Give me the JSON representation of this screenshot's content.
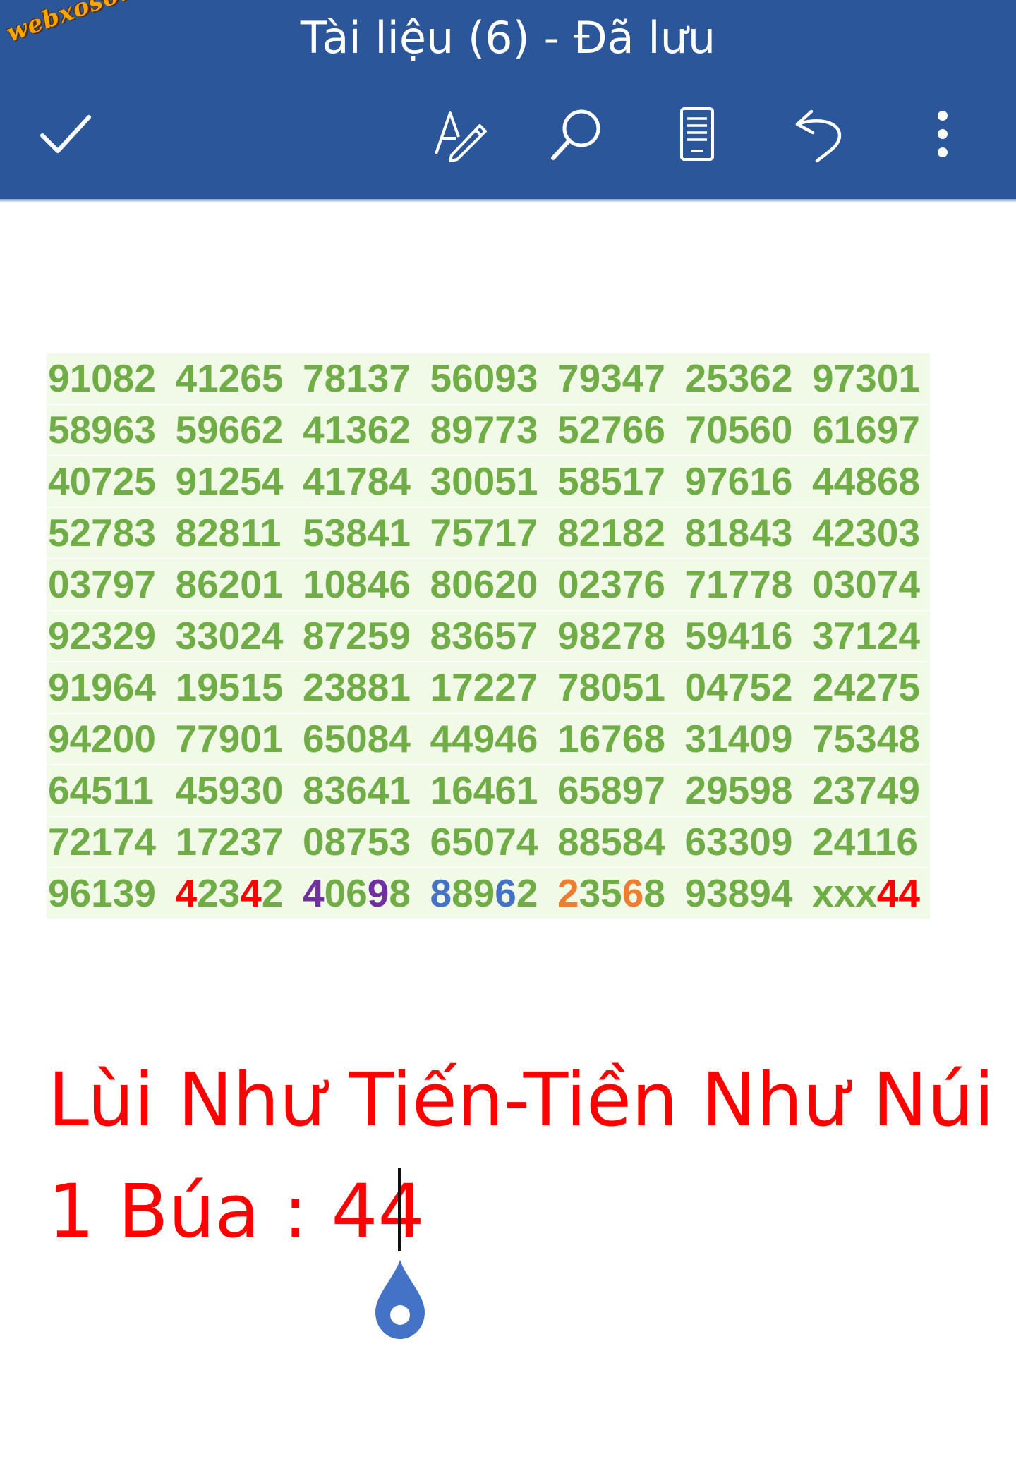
{
  "watermark": "webxoso.net",
  "header": {
    "title": "Tài liệu (6) - Đã lưu",
    "icons": {
      "done": "check-icon",
      "edit": "draw-pen-icon",
      "search": "search-icon",
      "view": "reading-view-icon",
      "undo": "undo-icon",
      "more": "more-vertical-icon"
    },
    "colors": {
      "bar": "#2b579a",
      "text": "#ffffff"
    }
  },
  "grid": {
    "rows": [
      [
        "91082",
        "41265",
        "78137",
        "56093",
        "79347",
        "25362",
        "97301"
      ],
      [
        "58963",
        "59662",
        "41362",
        "89773",
        "52766",
        "70560",
        "61697"
      ],
      [
        "40725",
        "91254",
        "41784",
        "30051",
        "58517",
        "97616",
        "44868"
      ],
      [
        "52783",
        "82811",
        "53841",
        "75717",
        "82182",
        "81843",
        "42303"
      ],
      [
        "03797",
        "86201",
        "10846",
        "80620",
        "02376",
        "71778",
        "03074"
      ],
      [
        "92329",
        "33024",
        "87259",
        "83657",
        "98278",
        "59416",
        "37124"
      ],
      [
        "91964",
        "19515",
        "23881",
        "17227",
        "78051",
        "04752",
        "24275"
      ],
      [
        "94200",
        "77901",
        "65084",
        "44946",
        "16768",
        "31409",
        "75348"
      ],
      [
        "64511",
        "45930",
        "83641",
        "16461",
        "65897",
        "29598",
        "23749"
      ],
      [
        "72174",
        "17237",
        "08753",
        "65074",
        "88584",
        "63309",
        "24116"
      ]
    ],
    "last_row": {
      "n1": "96139",
      "n2": [
        "4",
        "23",
        "4",
        "2"
      ],
      "n3": [
        "4",
        "06",
        "9",
        "8"
      ],
      "n4": [
        "8",
        "89",
        "6",
        "2"
      ],
      "n5": [
        "2",
        "35",
        "6",
        "8"
      ],
      "n6": "93894",
      "n7": [
        "xxx",
        "44"
      ]
    },
    "colors": {
      "number": "#70ad47",
      "highlight": "#f0fae6",
      "red": "#ff0000",
      "purple": "#7030a0",
      "blue": "#4472c4",
      "orange": "#ed7d31"
    }
  },
  "body": {
    "line1": "Lùi Như Tiến-Tiền Như Núi",
    "line2": "1 Búa : 44",
    "color": "#ff0000"
  }
}
